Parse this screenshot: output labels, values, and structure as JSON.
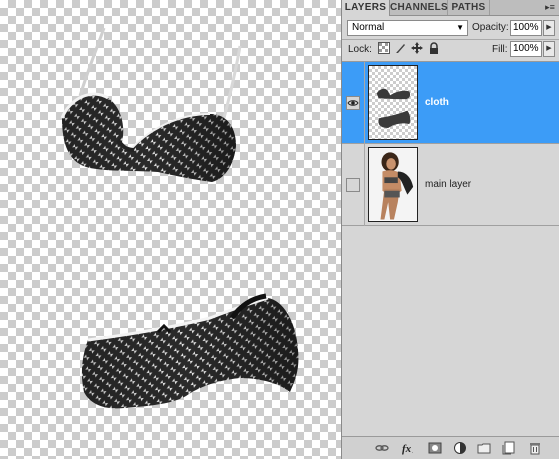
{
  "panel": {
    "tabs": [
      {
        "label": "LAYERS"
      },
      {
        "label": "CHANNELS"
      },
      {
        "label": "PATHS"
      }
    ],
    "blend_mode": "Normal",
    "opacity_label": "Opacity:",
    "opacity_value": "100%",
    "lock_label": "Lock:",
    "fill_label": "Fill:",
    "fill_value": "100%"
  },
  "layers": [
    {
      "name": "cloth",
      "selected": true,
      "visible": true
    },
    {
      "name": "main layer",
      "selected": false,
      "visible": false
    }
  ],
  "footer_icons": [
    "link-layers-icon",
    "fx-icon",
    "add-mask-icon",
    "adjustment-layer-icon",
    "new-group-icon",
    "new-layer-icon",
    "trash-icon"
  ],
  "colors": {
    "selection": "#3c9cf7",
    "panel_bg": "#d6d6d6"
  }
}
